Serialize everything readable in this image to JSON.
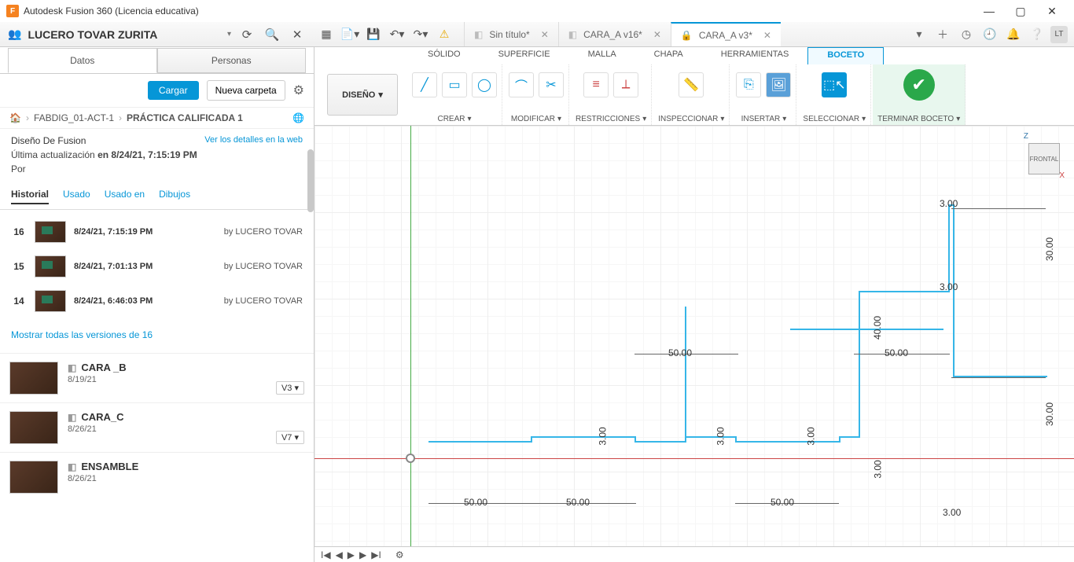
{
  "app_title": "Autodesk Fusion 360 (Licencia educativa)",
  "app_icon_letter": "F",
  "user_name": "LUCERO TOVAR ZURITA",
  "avatar_initials": "LT",
  "doc_tabs": [
    {
      "label": "Sin título*",
      "icon": "cube",
      "active": false
    },
    {
      "label": "CARA_A v16*",
      "icon": "cube",
      "active": false
    },
    {
      "label": "CARA_A v3*",
      "icon": "lock",
      "active": true
    }
  ],
  "side_tabs": {
    "datos": "Datos",
    "personas": "Personas"
  },
  "actions": {
    "load": "Cargar",
    "new_folder": "Nueva carpeta"
  },
  "breadcrumb": {
    "p1": "FABDIG_01-ACT-1",
    "p2": "PRÁCTICA CALIFICADA 1"
  },
  "design": {
    "title": "Diseño De Fusion",
    "details_link": "Ver los detalles en la web",
    "updated_label": "Última actualización",
    "updated_bold": "en 8/24/21, 7:15:19 PM",
    "por": "Por"
  },
  "subtabs": {
    "historial": "Historial",
    "usado": "Usado",
    "usado_en": "Usado en",
    "dibujos": "Dibujos"
  },
  "history": [
    {
      "num": "16",
      "ts": "8/24/21, 7:15:19 PM",
      "by": "by LUCERO TOVAR"
    },
    {
      "num": "15",
      "ts": "8/24/21, 7:01:13 PM",
      "by": "by LUCERO TOVAR"
    },
    {
      "num": "14",
      "ts": "8/24/21, 6:46:03 PM",
      "by": "by LUCERO TOVAR"
    }
  ],
  "show_all": "Mostrar todas las versiones de 16",
  "files": [
    {
      "name": "CARA _B",
      "date": "8/19/21",
      "ver": "V3 ▾"
    },
    {
      "name": "CARA_C",
      "date": "8/26/21",
      "ver": "V7 ▾"
    },
    {
      "name": "ENSAMBLE",
      "date": "8/26/21",
      "ver": ""
    }
  ],
  "ctx_tabs": [
    "SÓLIDO",
    "SUPERFICIE",
    "MALLA",
    "CHAPA",
    "HERRAMIENTAS",
    "BOCETO"
  ],
  "design_dd": "DISEÑO",
  "ribbon_groups": {
    "crear": "CREAR",
    "modificar": "MODIFICAR",
    "restricciones": "RESTRICCIONES",
    "inspeccionar": "INSPECCIONAR",
    "insertar": "INSERTAR",
    "seleccionar": "SELECCIONAR",
    "terminar": "TERMINAR BOCETO"
  },
  "viewcube": {
    "face": "FRONTAL",
    "z": "Z",
    "x": "X"
  },
  "dims": {
    "d50": "50.00",
    "d3": "3.00",
    "d30": "30.00",
    "d40": "40.00"
  }
}
